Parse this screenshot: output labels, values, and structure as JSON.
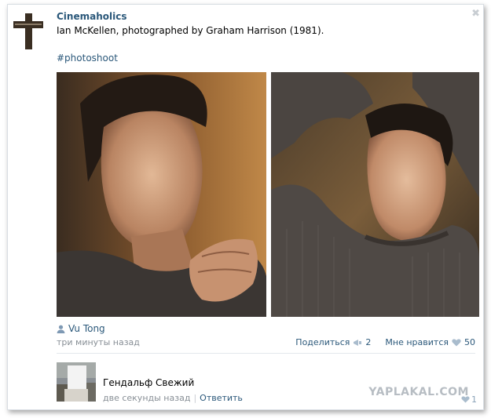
{
  "post": {
    "group_name": "Cinemaholics",
    "text": "Ian McKellen, photographed by Graham Harrison (1981).",
    "hashtag": "#photoshoot",
    "close_symbol": "✖",
    "author": "Vu Tong",
    "time": "три минуты назад",
    "share_label": "Поделиться",
    "share_count": "2",
    "like_label": "Мне нравится",
    "like_count": "50"
  },
  "comment": {
    "author": "Гендальф Свежий",
    "time": "две секунды назад",
    "separator": "|",
    "reply_label": "Ответить",
    "like_count": "1"
  },
  "watermark": "YAPLAKAL.COM",
  "colors": {
    "link": "#2b587a",
    "muted": "#888f96",
    "photo_warm": "#b5793f",
    "photo_dark": "#2e2a26"
  },
  "icons": {
    "author": "person-icon",
    "share": "megaphone-icon",
    "like": "heart-icon",
    "close": "close-icon"
  }
}
